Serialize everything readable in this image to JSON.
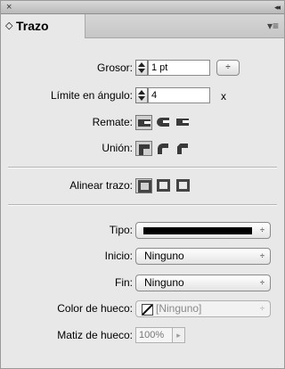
{
  "panel": {
    "close_glyph": "×",
    "collapse_glyph": "◂◂",
    "tab_arrows_glyph": "◇",
    "tab_title": "Trazo",
    "menu_glyph": "▾≡"
  },
  "grosor": {
    "label": "Grosor:",
    "value": "1 pt",
    "popup_glyph": "÷"
  },
  "limite": {
    "label": "Límite en ángulo:",
    "value": "4",
    "suffix": "x"
  },
  "remate": {
    "label": "Remate:"
  },
  "union": {
    "label": "Unión:"
  },
  "alinear": {
    "label": "Alinear trazo:"
  },
  "tipo": {
    "label": "Tipo:",
    "arrow": "÷"
  },
  "inicio": {
    "label": "Inicio:",
    "value": "Ninguno",
    "arrow": "÷"
  },
  "fin": {
    "label": "Fin:",
    "value": "Ninguno",
    "arrow": "÷"
  },
  "color_hueco": {
    "label": "Color de hueco:",
    "value": "[Ninguno]",
    "arrow": "÷"
  },
  "matiz_hueco": {
    "label": "Matiz de hueco:",
    "value": "100%",
    "arrow": "▸"
  }
}
